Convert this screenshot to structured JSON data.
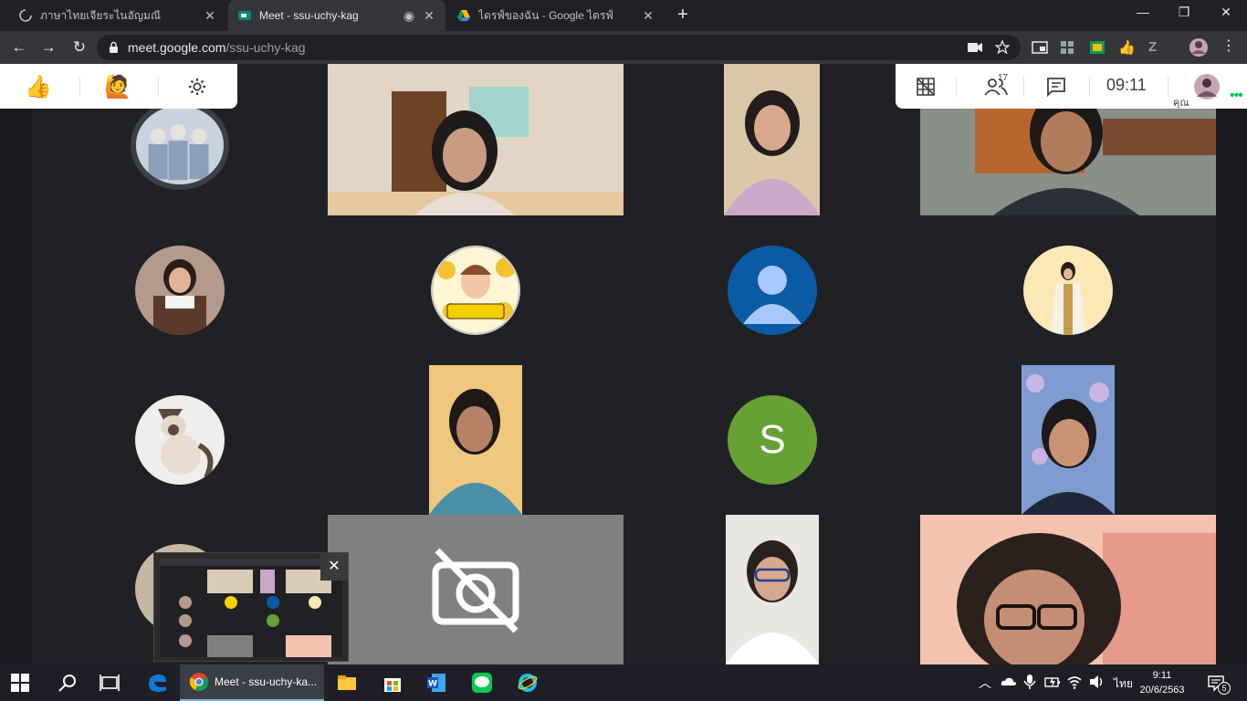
{
  "browser": {
    "tabs": [
      {
        "title": "ภาษาไทยเจียระไนอัญมณี",
        "active": false
      },
      {
        "title": "Meet - ssu-uchy-kag",
        "active": true
      },
      {
        "title": "ไดรฟ์ของฉัน - Google ไดรฟ์",
        "active": false
      }
    ],
    "url_host": "meet.google.com",
    "url_path": "/ssu-uchy-kag"
  },
  "meet": {
    "participants_count": "17",
    "clock": "09:11",
    "you_label": "คุณ",
    "avatar_letter": "S"
  },
  "taskbar": {
    "active_app_label": "Meet - ssu-uchy-ka...",
    "language": "ไทย",
    "time": "9:11",
    "date": "20/6/2563",
    "notifications": "5"
  },
  "colors": {
    "stage_bg": "#202124",
    "avatar_blue": "#0b5aa6",
    "avatar_green": "#67a035",
    "accent_green": "#00c853"
  }
}
